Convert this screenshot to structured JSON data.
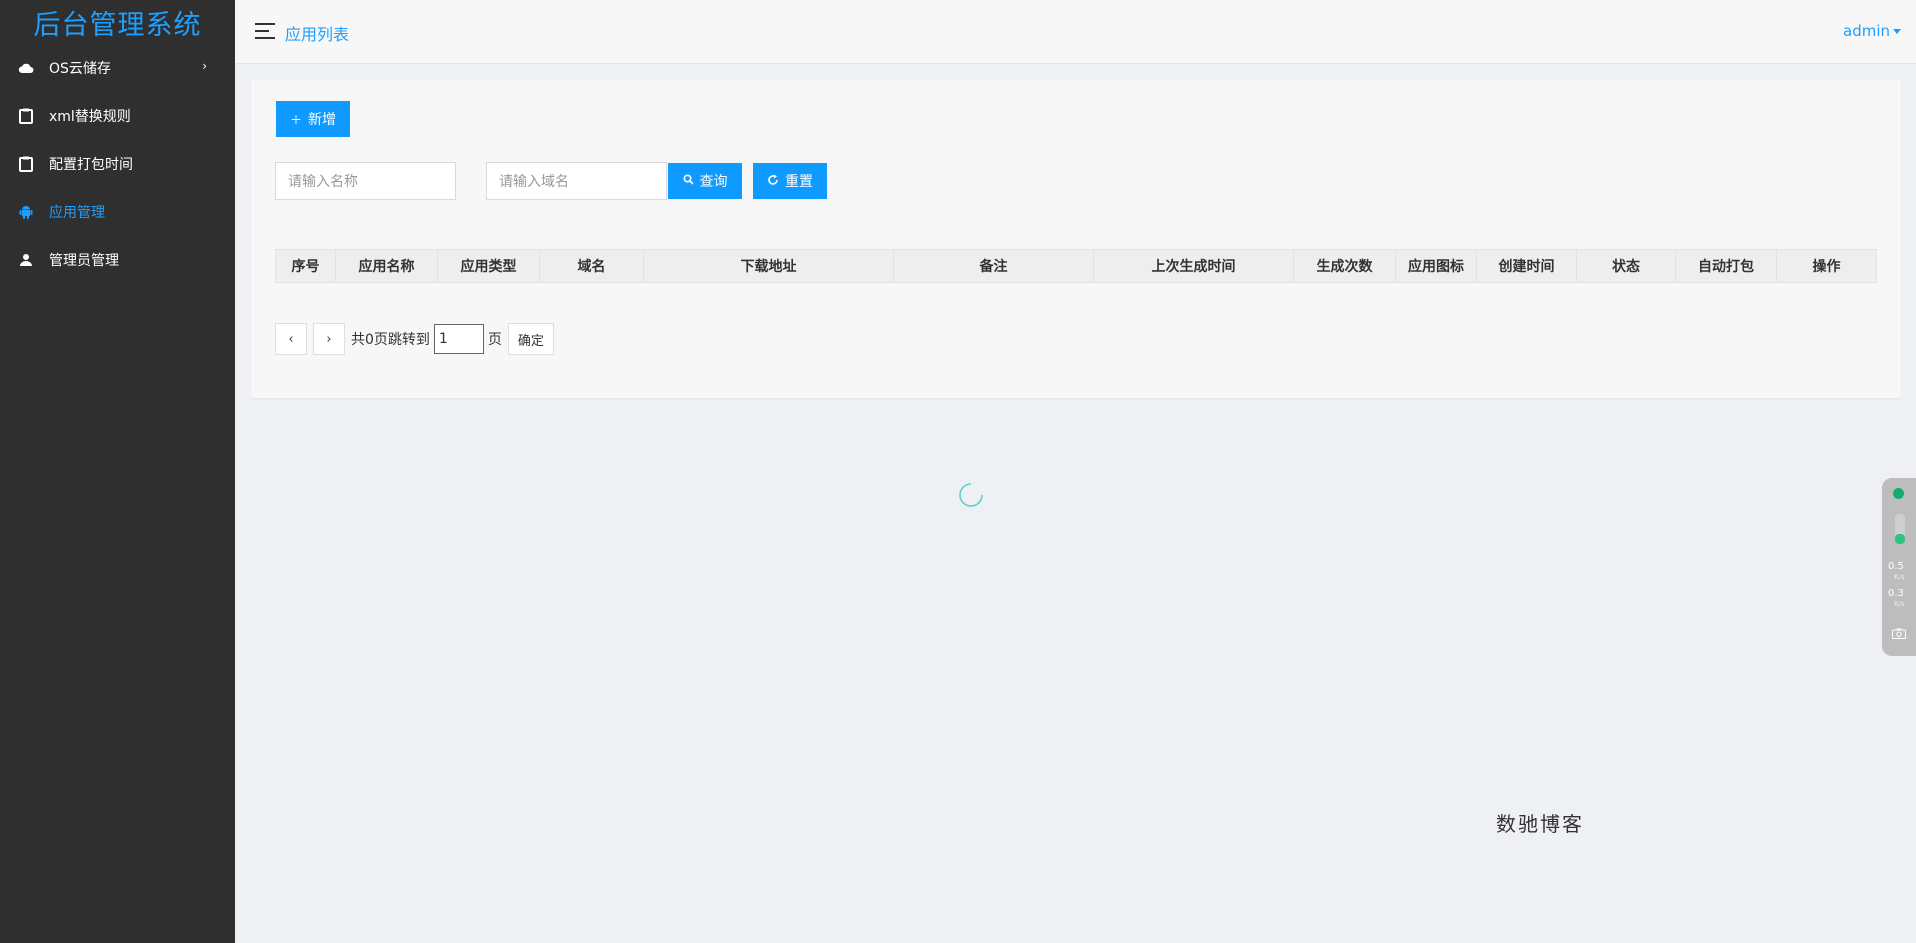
{
  "brand": "后台管理系统",
  "sidebar": {
    "items": [
      {
        "label": "OS云储存",
        "icon": "cloud-icon",
        "arrow": "›"
      },
      {
        "label": "xml替换规则",
        "icon": "clipboard-icon"
      },
      {
        "label": "配置打包时间",
        "icon": "clipboard-icon"
      },
      {
        "label": "应用管理",
        "icon": "android-icon",
        "active": true
      },
      {
        "label": "管理员管理",
        "icon": "user-icon"
      }
    ]
  },
  "header": {
    "title": "应用列表",
    "user": "admin"
  },
  "toolbar": {
    "add_label": "新增",
    "query_label": "查询",
    "reset_label": "重置"
  },
  "search": {
    "name_placeholder": "请输入名称",
    "domain_placeholder": "请输入域名"
  },
  "table": {
    "columns": [
      "序号",
      "应用名称",
      "应用类型",
      "域名",
      "下载地址",
      "备注",
      "上次生成时间",
      "生成次数",
      "应用图标",
      "创建时间",
      "状态",
      "自动打包",
      "操作"
    ]
  },
  "pager": {
    "prev": "‹",
    "next": "›",
    "total_text": "共0页跳转到",
    "page_value": "1",
    "page_suffix": "页",
    "confirm": "确定"
  },
  "watermark": "数驰博客",
  "widget": {
    "upload_speed": "0.5",
    "download_speed": "0.3",
    "unit": "K/s"
  },
  "colors": {
    "accent": "#1e9fff",
    "button": "#0e9aff",
    "sidebar_bg": "#2f2f2f"
  }
}
